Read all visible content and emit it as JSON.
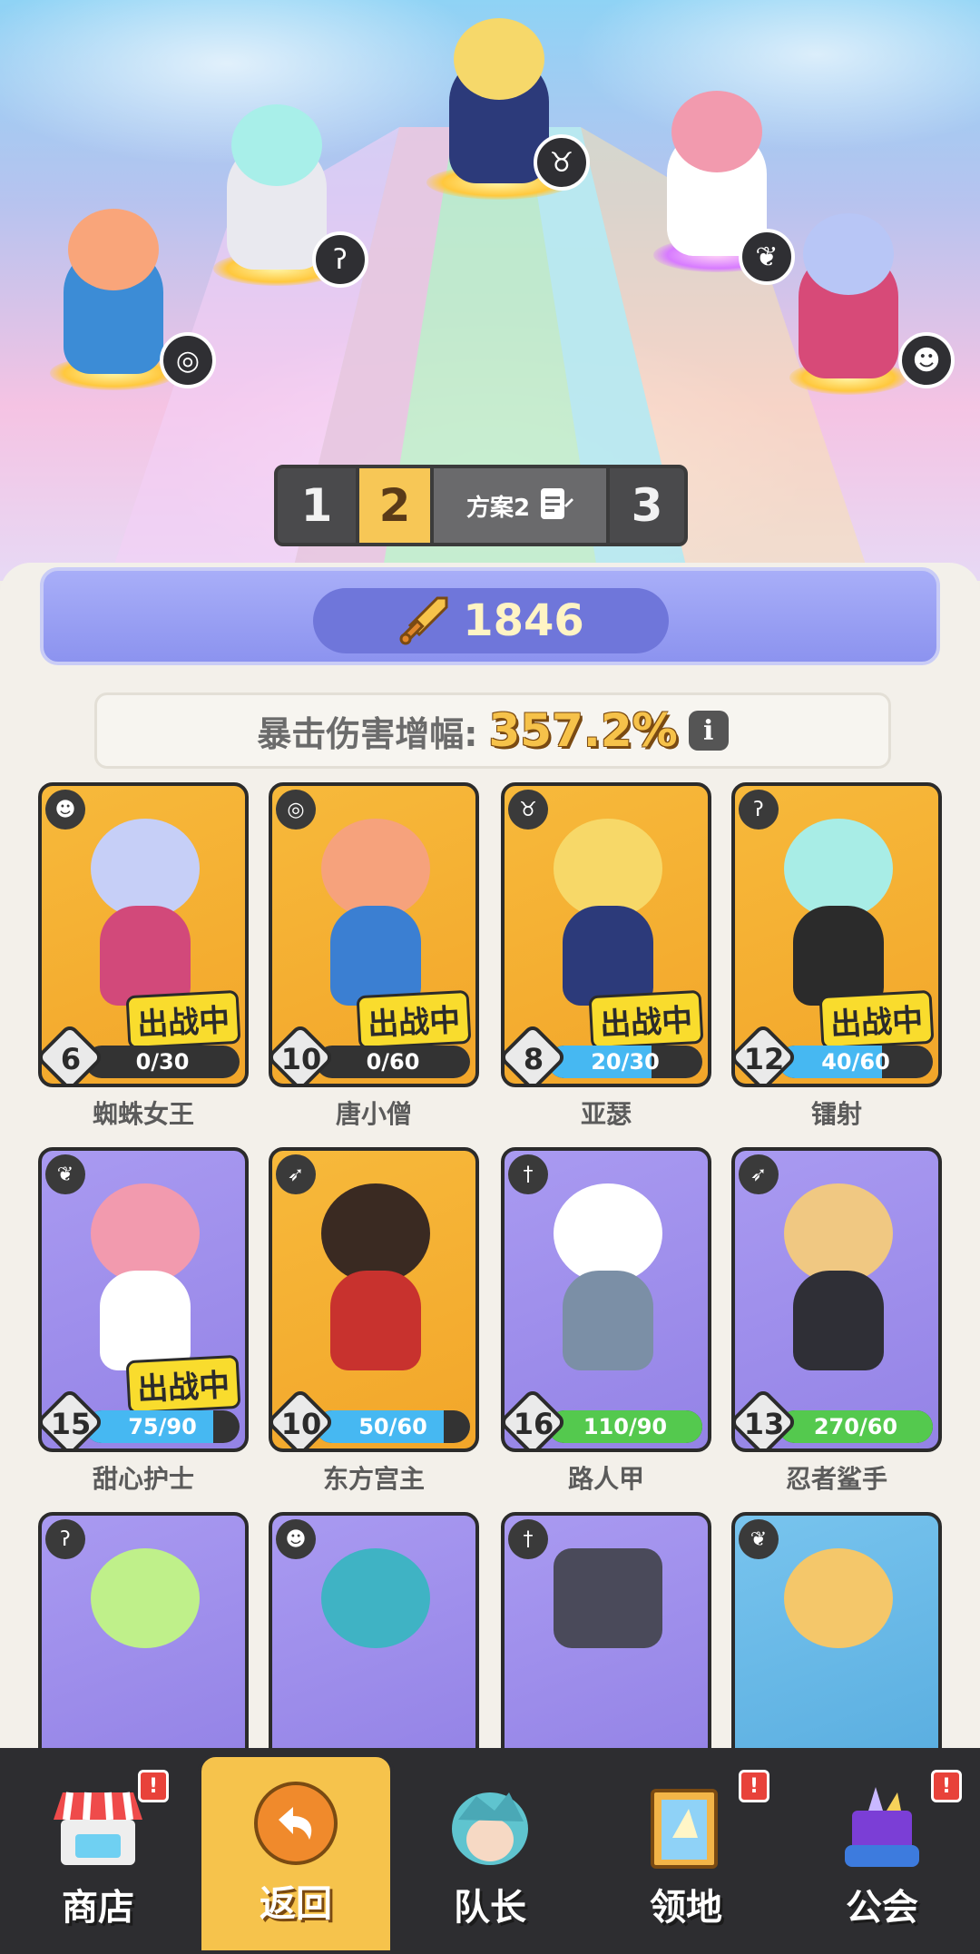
{
  "team_plans": {
    "plan1": "1",
    "plan2": "2",
    "plan_name": "方案2",
    "plan3": "3",
    "active": "2"
  },
  "power": "1846",
  "crit": {
    "label": "暴击伤害增幅:",
    "value": "357.2%",
    "info": "i"
  },
  "heroes": [
    {
      "name": "蜘蛛女王",
      "level": "6",
      "progress": "0/30",
      "fraction": 0,
      "deployed": "出战中",
      "color": "gold"
    },
    {
      "name": "唐小僧",
      "level": "10",
      "progress": "0/60",
      "fraction": 0,
      "deployed": "出战中",
      "color": "gold"
    },
    {
      "name": "亚瑟",
      "level": "8",
      "progress": "20/30",
      "fraction": 0.67,
      "deployed": "出战中",
      "color": "gold"
    },
    {
      "name": "镭射",
      "level": "12",
      "progress": "40/60",
      "fraction": 0.67,
      "deployed": "出战中",
      "color": "gold"
    },
    {
      "name": "甜心护士",
      "level": "15",
      "progress": "75/90",
      "fraction": 0.83,
      "deployed": "出战中",
      "color": "purple"
    },
    {
      "name": "东方宫主",
      "level": "10",
      "progress": "50/60",
      "fraction": 0.83,
      "deployed": "",
      "color": "gold"
    },
    {
      "name": "路人甲",
      "level": "16",
      "progress": "110/90",
      "fraction": 1,
      "deployed": "",
      "color": "purple"
    },
    {
      "name": "忍者鲨手",
      "level": "13",
      "progress": "270/60",
      "fraction": 1,
      "deployed": "",
      "color": "purple"
    }
  ],
  "nav": {
    "shop": "商店",
    "back": "返回",
    "captain": "队长",
    "territory": "领地",
    "guild": "公会",
    "alert": "!"
  },
  "colors": {
    "gold_card": "#f7b93b",
    "purple_card": "#a99af1",
    "sky_card": "#78c4ee",
    "progress_blue": "#46b8f2",
    "progress_green": "#54c94e",
    "accent_yellow": "#f6c34c"
  }
}
